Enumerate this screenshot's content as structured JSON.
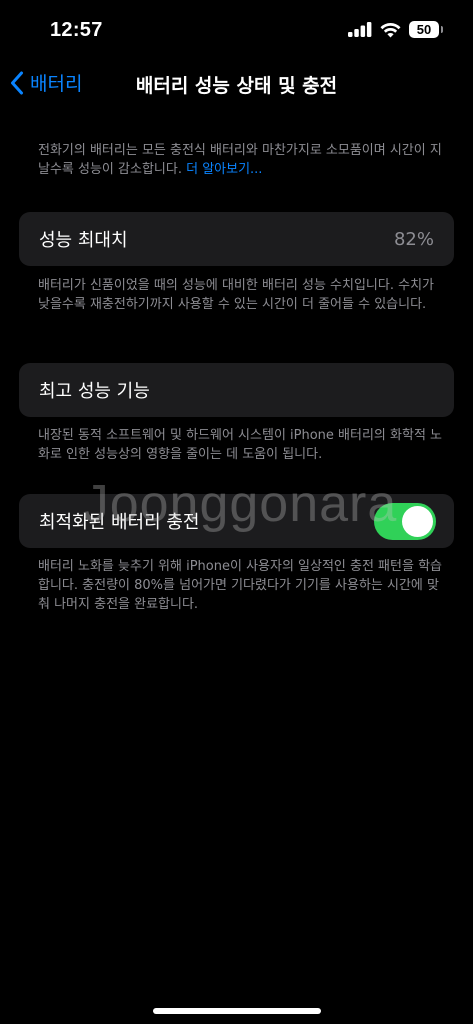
{
  "status_bar": {
    "time": "12:57",
    "battery_level": "50",
    "icons": [
      "cellular-signal-icon",
      "wifi-icon",
      "battery-icon"
    ]
  },
  "nav": {
    "back_label": "배터리",
    "title": "배터리 성능 상태 및 충전"
  },
  "intro": {
    "text": "전화기의 배터리는 모든 충전식 배터리와 마찬가지로 소모품이며 시간이 지날수록 성능이 감소합니다.",
    "learn_more": "더 알아보기..."
  },
  "max_capacity": {
    "label": "성능 최대치",
    "value": "82%",
    "footnote": "배터리가 신품이었을 때의 성능에 대비한 배터리 성능 수치입니다. 수치가 낮을수록 재충전하기까지 사용할 수 있는 시간이 더 줄어들 수 있습니다."
  },
  "peak_performance": {
    "label": "최고 성능 기능",
    "footnote": "내장된 동적 소프트웨어 및 하드웨어 시스템이 iPhone 배터리의 화학적 노화로 인한 성능상의 영향을 줄이는 데 도움이 됩니다."
  },
  "optimized_charging": {
    "label": "최적화된 배터리 충전",
    "enabled": true,
    "footnote": "배터리 노화를 늦추기 위해 iPhone이 사용자의 일상적인 충전 패턴을 학습합니다. 충전량이 80%를 넘어가면 기다렸다가 기기를 사용하는 시간에 맞춰 나머지 충전을 완료합니다."
  },
  "watermark": "Joonggonara",
  "colors": {
    "background": "#000000",
    "cell": "#1c1c1e",
    "accent": "#0a84ff",
    "toggle_on": "#30d158",
    "secondary_text": "#8d8d93"
  }
}
